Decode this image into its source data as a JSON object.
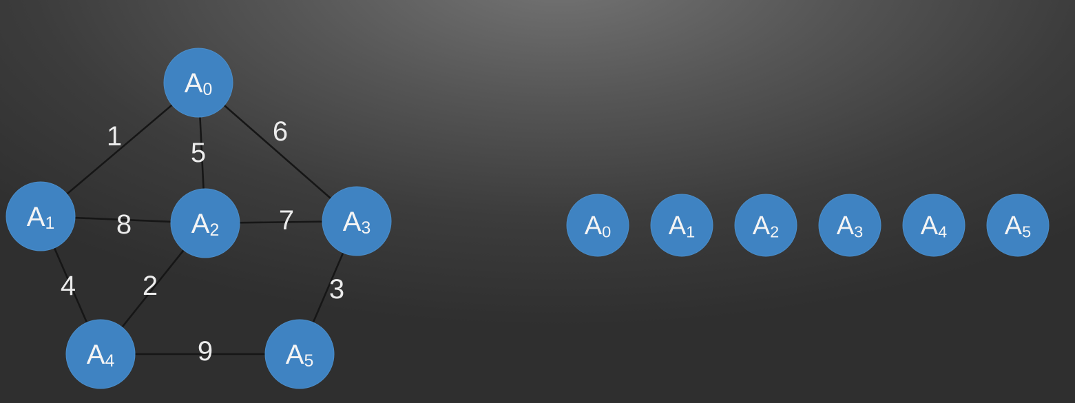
{
  "graph": {
    "nodes": [
      {
        "id": "A0",
        "letter": "A",
        "sub": "0"
      },
      {
        "id": "A1",
        "letter": "A",
        "sub": "1"
      },
      {
        "id": "A2",
        "letter": "A",
        "sub": "2"
      },
      {
        "id": "A3",
        "letter": "A",
        "sub": "3"
      },
      {
        "id": "A4",
        "letter": "A",
        "sub": "4"
      },
      {
        "id": "A5",
        "letter": "A",
        "sub": "5"
      }
    ],
    "edges": [
      {
        "from": "A0",
        "to": "A1",
        "weight": "1"
      },
      {
        "from": "A0",
        "to": "A2",
        "weight": "5"
      },
      {
        "from": "A0",
        "to": "A3",
        "weight": "6"
      },
      {
        "from": "A1",
        "to": "A2",
        "weight": "8"
      },
      {
        "from": "A2",
        "to": "A3",
        "weight": "7"
      },
      {
        "from": "A1",
        "to": "A4",
        "weight": "4"
      },
      {
        "from": "A2",
        "to": "A4",
        "weight": "2"
      },
      {
        "from": "A3",
        "to": "A5",
        "weight": "3"
      },
      {
        "from": "A4",
        "to": "A5",
        "weight": "9"
      }
    ]
  },
  "node_row": [
    {
      "id": "A0",
      "letter": "A",
      "sub": "0"
    },
    {
      "id": "A1",
      "letter": "A",
      "sub": "1"
    },
    {
      "id": "A2",
      "letter": "A",
      "sub": "2"
    },
    {
      "id": "A3",
      "letter": "A",
      "sub": "3"
    },
    {
      "id": "A4",
      "letter": "A",
      "sub": "4"
    },
    {
      "id": "A5",
      "letter": "A",
      "sub": "5"
    }
  ],
  "colors": {
    "node_fill": "#3f83c2",
    "edge": "#161616",
    "text": "#f4f4f4"
  }
}
